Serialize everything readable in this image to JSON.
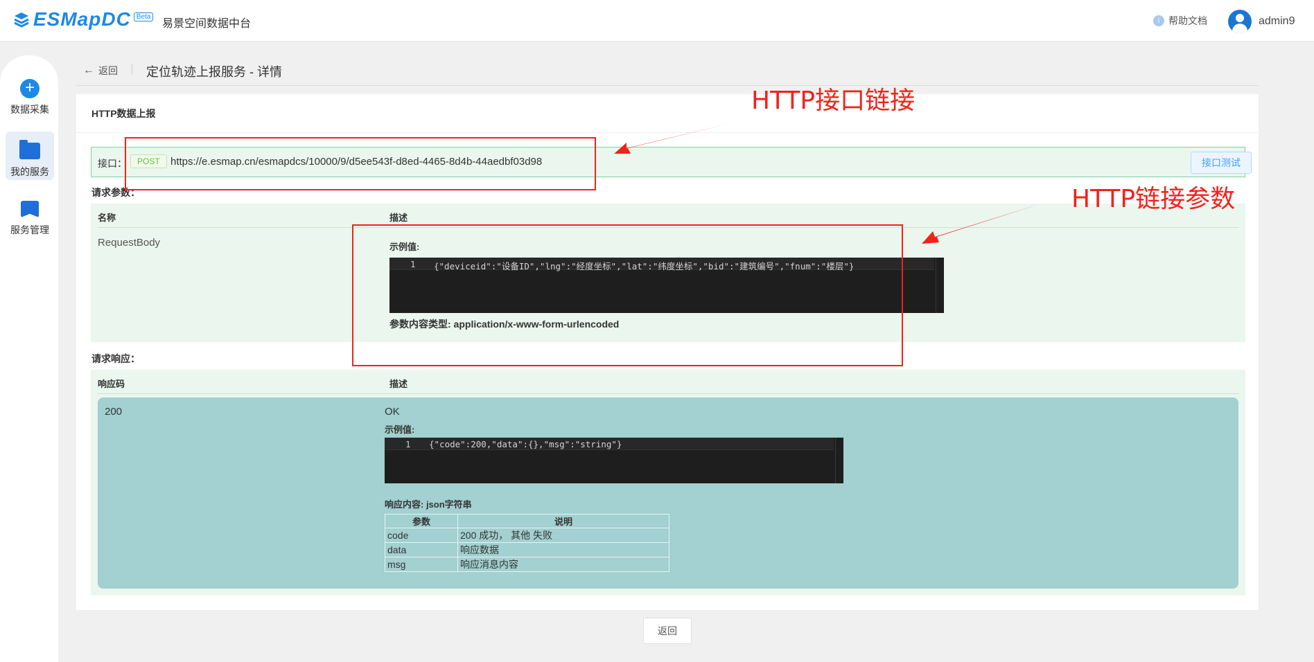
{
  "header": {
    "logo_text": "ESMapDC",
    "beta_badge": "Beta",
    "app_name": "易景空间数据中台",
    "help_label": "帮助文档",
    "username": "admin9"
  },
  "sidebar": {
    "items": [
      {
        "label": "数据采集",
        "icon": "plus-icon"
      },
      {
        "label": "我的服务",
        "icon": "folder-icon",
        "active": true
      },
      {
        "label": "服务管理",
        "icon": "bookmark-icon"
      }
    ]
  },
  "topbar": {
    "back_label": "返回",
    "page_title": "定位轨迹上报服务 - 详情"
  },
  "card": {
    "title": "HTTP数据上报",
    "api": {
      "label": "接口：",
      "method": "POST",
      "url": "https://e.esmap.cn/esmapdcs/10000/9/d5ee543f-d8ed-4465-8d4b-44aedbf03d98",
      "test_button": "接口测试"
    },
    "request": {
      "section_label": "请求参数：",
      "columns": [
        "名称",
        "描述"
      ],
      "row": {
        "name": "RequestBody",
        "example_label": "示例值:",
        "code_line_no": "1",
        "code": "{\"deviceid\":\"设备ID\",\"lng\":\"经度坐标\",\"lat\":\"纬度坐标\",\"bid\":\"建筑编号\",\"fnum\":\"楼层\"}",
        "content_type": "参数内容类型: application/x-www-form-urlencoded"
      }
    },
    "response": {
      "section_label": "请求响应：",
      "columns": [
        "响应码",
        "描述"
      ],
      "row": {
        "code": "200",
        "desc": "OK",
        "example_label": "示例值:",
        "code_line_no": "1",
        "example_code": "{\"code\":200,\"data\":{},\"msg\":\"string\"}",
        "content_label": "响应内容: json字符串",
        "fields_header": [
          "参数",
          "说明"
        ],
        "fields": [
          [
            "code",
            "200 成功， 其他 失败"
          ],
          [
            "data",
            "响应数据"
          ],
          [
            "msg",
            "响应消息内容"
          ]
        ]
      }
    }
  },
  "footer": {
    "back_button": "返回"
  },
  "annotations": {
    "label_1": "HTTP接口链接",
    "label_2": "HTTP链接参数",
    "color": "#f4211b"
  }
}
